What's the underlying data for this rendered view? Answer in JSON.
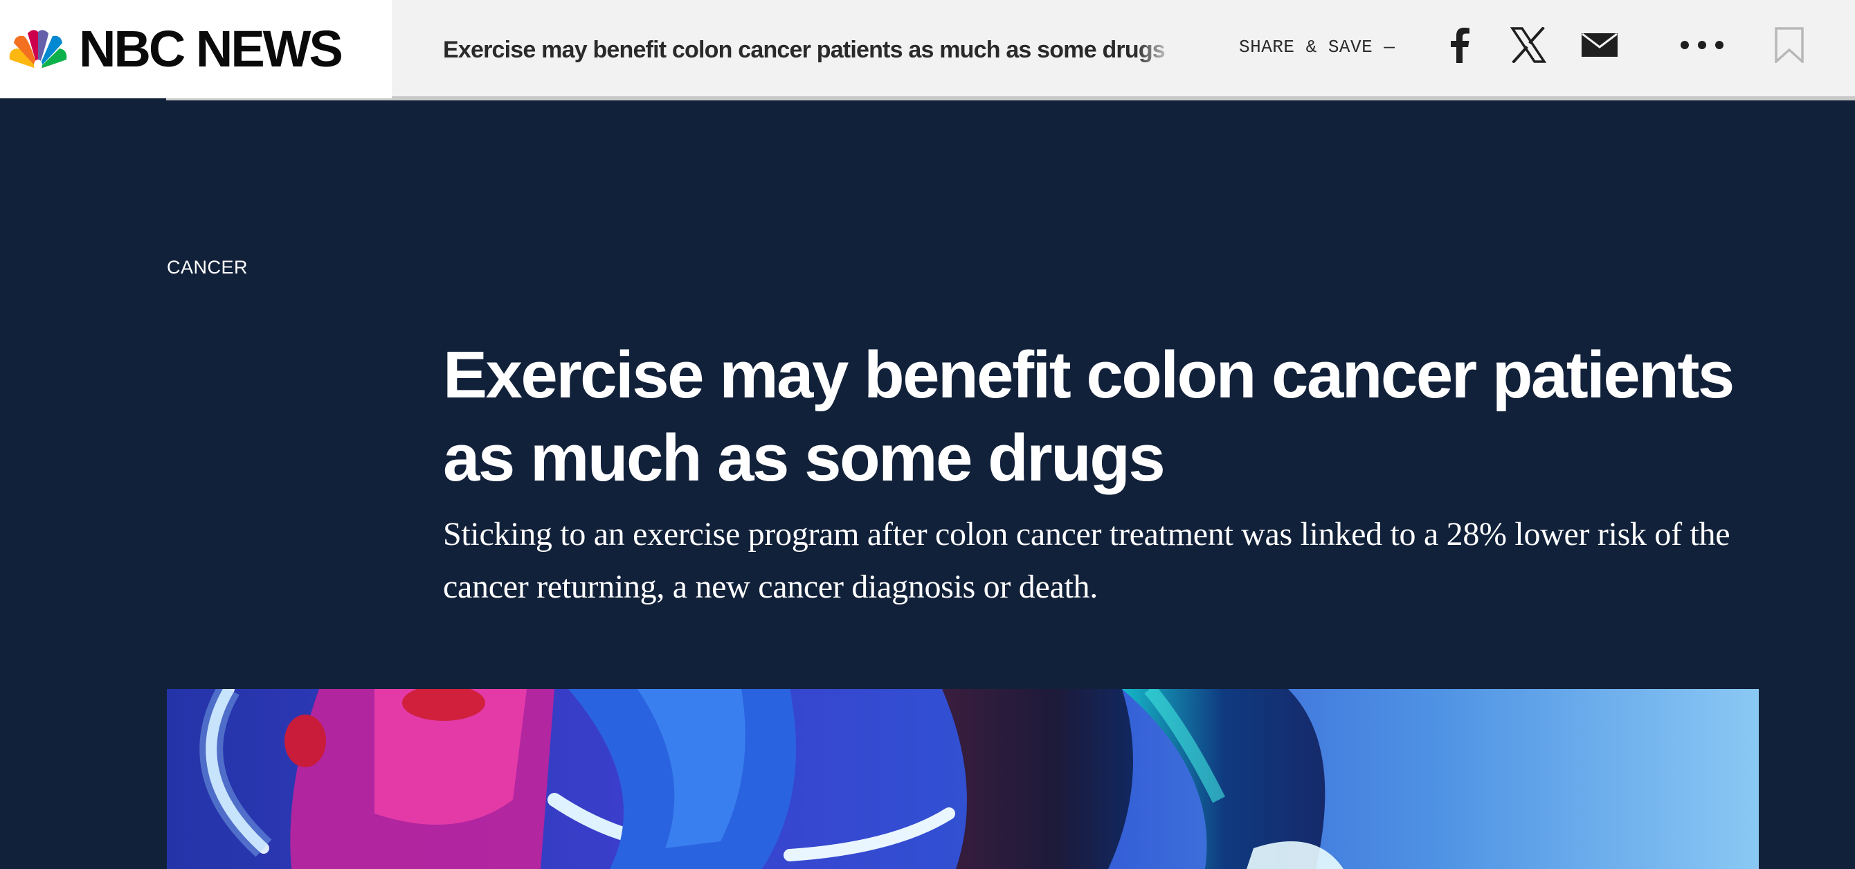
{
  "header": {
    "logo_text": "NBC NEWS",
    "article_title": "Exercise may benefit colon cancer patients as much as some drugs",
    "share_label": "SHARE & SAVE —",
    "icons": [
      "peacock-logo-icon",
      "facebook-icon",
      "x-icon",
      "mail-icon",
      "more-icon",
      "bookmark-icon"
    ]
  },
  "article": {
    "section": "CANCER",
    "headline": "Exercise may benefit colon cancer patients as much as some drugs",
    "dek": "Sticking to an exercise program after colon cancer treatment was linked to a 28% lower risk of the cancer returning, a new cancer diagnosis or death."
  },
  "colors": {
    "hero_background": "#12213a",
    "header_background": "#f2f2f2",
    "text_light": "#ffffff",
    "text_dark": "#2a2a2a"
  }
}
